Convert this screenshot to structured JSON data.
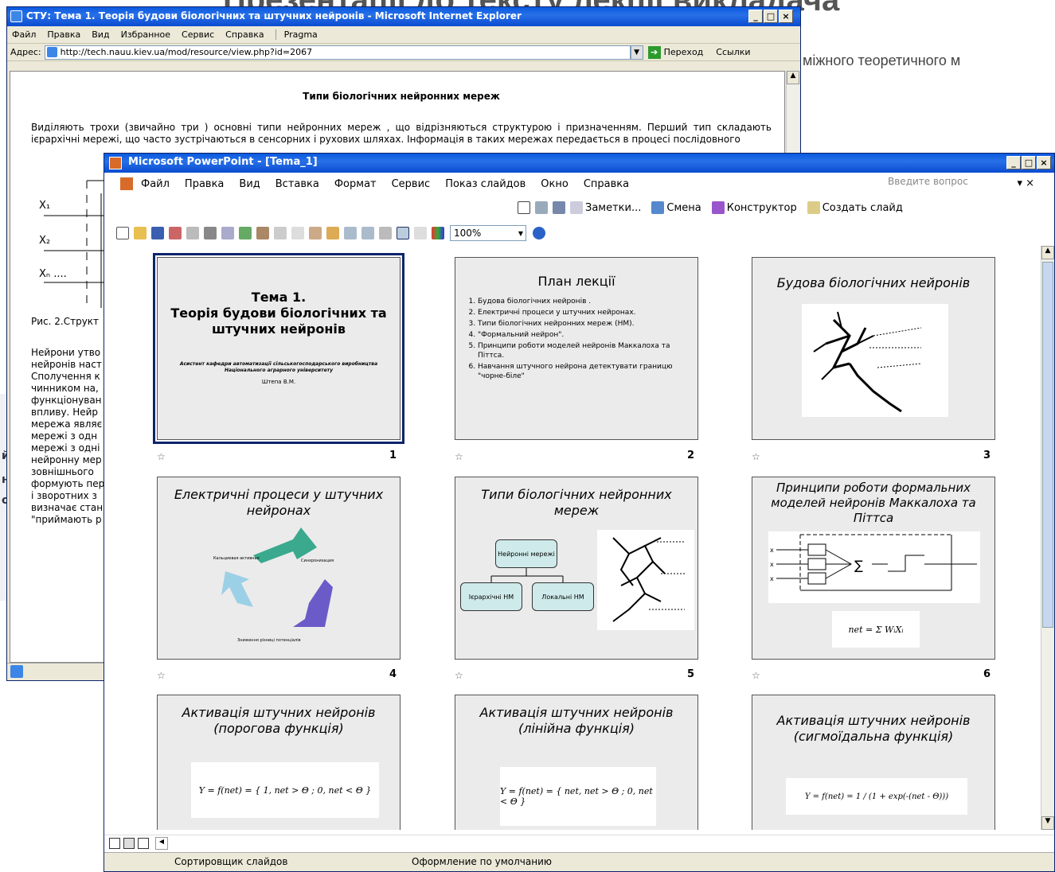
{
  "background": {
    "title": "Презентації до тексту лекції викладача",
    "subtitle": "міжного теоретичного м"
  },
  "ie": {
    "title": "СТУ: Тема 1. Теорія будови біологічних та штучних нейронів - Microsoft Internet Explorer",
    "menu": [
      "Файл",
      "Правка",
      "Вид",
      "Избранное",
      "Сервис",
      "Справка",
      "Pragma"
    ],
    "address_label": "Адрес:",
    "url": "http://tech.nauu.kiev.ua/mod/resource/view.php?id=2067",
    "go": "Переход",
    "links": "Ссылки",
    "heading": "Типи біологічних нейронних мереж",
    "para1": "Виділяють трохи (звичайно три ) основні типи нейронних мереж , що відрізняються структурою і призначенням. Перший тип складають ієрархічні мережі, що часто зустрічаються в сенсорних і рухових шляхах. Інформація в таких мережах передається в процесі послідовного",
    "inputs": [
      "X₁",
      "X₂",
      "Xₙ ...."
    ],
    "caption": "Рис. 2.Структ",
    "lines": [
      "Нейрони утво",
      "нейронів наст",
      "Сполучення к",
      "чинником на,",
      "функціонуван",
      "впливу. Нейр",
      "мережа являє",
      "мережі з одн",
      "мережі з одні",
      "нейронну мер",
      "зовнішнього",
      "формують пер",
      "і зворотних з",
      "визначає стан",
      "\"приймають р"
    ]
  },
  "ppt": {
    "title": "Microsoft PowerPoint - [Tema_1]",
    "menu": [
      "Файл",
      "Правка",
      "Вид",
      "Вставка",
      "Формат",
      "Сервис",
      "Показ слайдов",
      "Окно",
      "Справка"
    ],
    "question_placeholder": "Введите вопрос",
    "toolbar1": [
      "Заметки...",
      "Смена",
      "Конструктор",
      "Создать слайд"
    ],
    "zoom": "100%",
    "status_view": "Сортировщик слайдов",
    "status_design": "Оформление по умолчанию",
    "slides": [
      {
        "num": "1",
        "title": "Тема 1.\nТеорія будови біологічних та штучних нейронів",
        "author": "Асистент кафедри автоматизації сільськогосподарського виробництва Національного аграрного університету",
        "author2": "Штепа В.М."
      },
      {
        "num": "2",
        "title": "План лекції",
        "items": [
          "Будова біологічних нейронів .",
          "Електричні процеси у штучних нейронах.",
          "Типи біологічних нейронних мереж (НМ).",
          "\"Формальний нейрон\".",
          "Принципи роботи моделей нейронів Маккалоха та Піттса.",
          "Навчання штучного нейрона детектувати границю \"чорне-біле\""
        ]
      },
      {
        "num": "3",
        "title": "Будова біологічних нейронів"
      },
      {
        "num": "4",
        "title": "Електричні процеси у штучних нейронах"
      },
      {
        "num": "5",
        "title": "Типи біологічних нейронних мереж",
        "boxes": [
          "Нейронні мережі",
          "Ієрархічні НМ",
          "Локальні НМ"
        ]
      },
      {
        "num": "6",
        "title": "Принципи роботи формальних моделей нейронів Маккалоха та Піттса",
        "formula": "net = Σ WᵢXᵢ"
      },
      {
        "num": "",
        "title": "Активація штучних нейронів (порогова функція)",
        "formula": "Y = f(net) = { 1, net > Θ ; 0, net < Θ }"
      },
      {
        "num": "",
        "title": "Активація штучних нейронів (лінійна функція)",
        "formula": "Y = f(net) = { net, net > Θ ; 0, net < Θ }"
      },
      {
        "num": "",
        "title": "Активація штучних нейронів (сигмоїдальна функція)",
        "formula": "Y = f(net) = 1 / (1 + exp(-(net - Θ)))"
      }
    ]
  }
}
